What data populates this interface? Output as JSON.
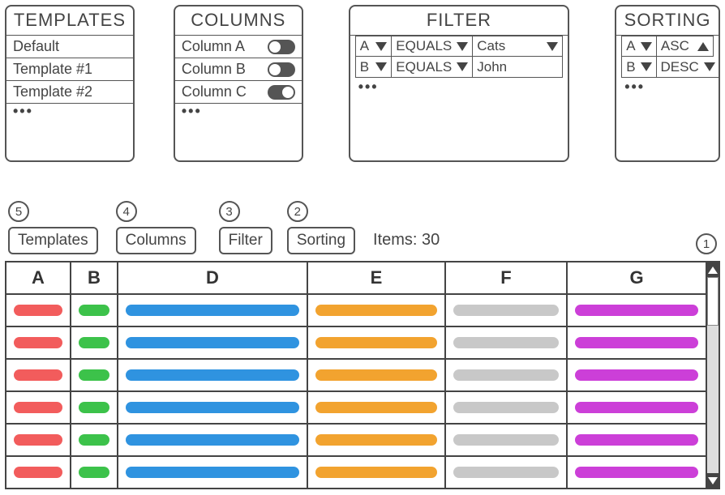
{
  "templates": {
    "title": "TEMPLATES",
    "items": [
      "Default",
      "Template #1",
      "Template #2"
    ],
    "more": "•••"
  },
  "columns": {
    "title": "COLUMNS",
    "items": [
      {
        "label": "Column A",
        "on": true
      },
      {
        "label": "Column B",
        "on": true
      },
      {
        "label": "Column C",
        "on": false
      }
    ],
    "more": "•••"
  },
  "filter": {
    "title": "FILTER",
    "rows": [
      {
        "col": "A",
        "op": "EQUALS",
        "val": "Cats",
        "hasValDropdown": true
      },
      {
        "col": "B",
        "op": "EQUALS",
        "val": "John",
        "hasValDropdown": false
      }
    ],
    "more": "•••"
  },
  "sorting": {
    "title": "SORTING",
    "rows": [
      {
        "col": "A",
        "dir": "ASC"
      },
      {
        "col": "B",
        "dir": "DESC"
      }
    ],
    "more": "•••"
  },
  "toolbar": {
    "buttons": [
      {
        "num": "5",
        "label": "Templates"
      },
      {
        "num": "4",
        "label": "Columns"
      },
      {
        "num": "3",
        "label": "Filter"
      },
      {
        "num": "2",
        "label": "Sorting"
      }
    ],
    "items_label": "Items: 30",
    "grid_num": "1"
  },
  "grid": {
    "headers": [
      "A",
      "B",
      "D",
      "E",
      "F",
      "G"
    ],
    "widths": [
      80,
      58,
      234,
      170,
      150,
      170
    ],
    "colors": [
      "#f25c5c",
      "#3cc24a",
      "#2f93e0",
      "#f2a32f",
      "#c8c8c8",
      "#cc3fd8"
    ],
    "rows": 6
  }
}
